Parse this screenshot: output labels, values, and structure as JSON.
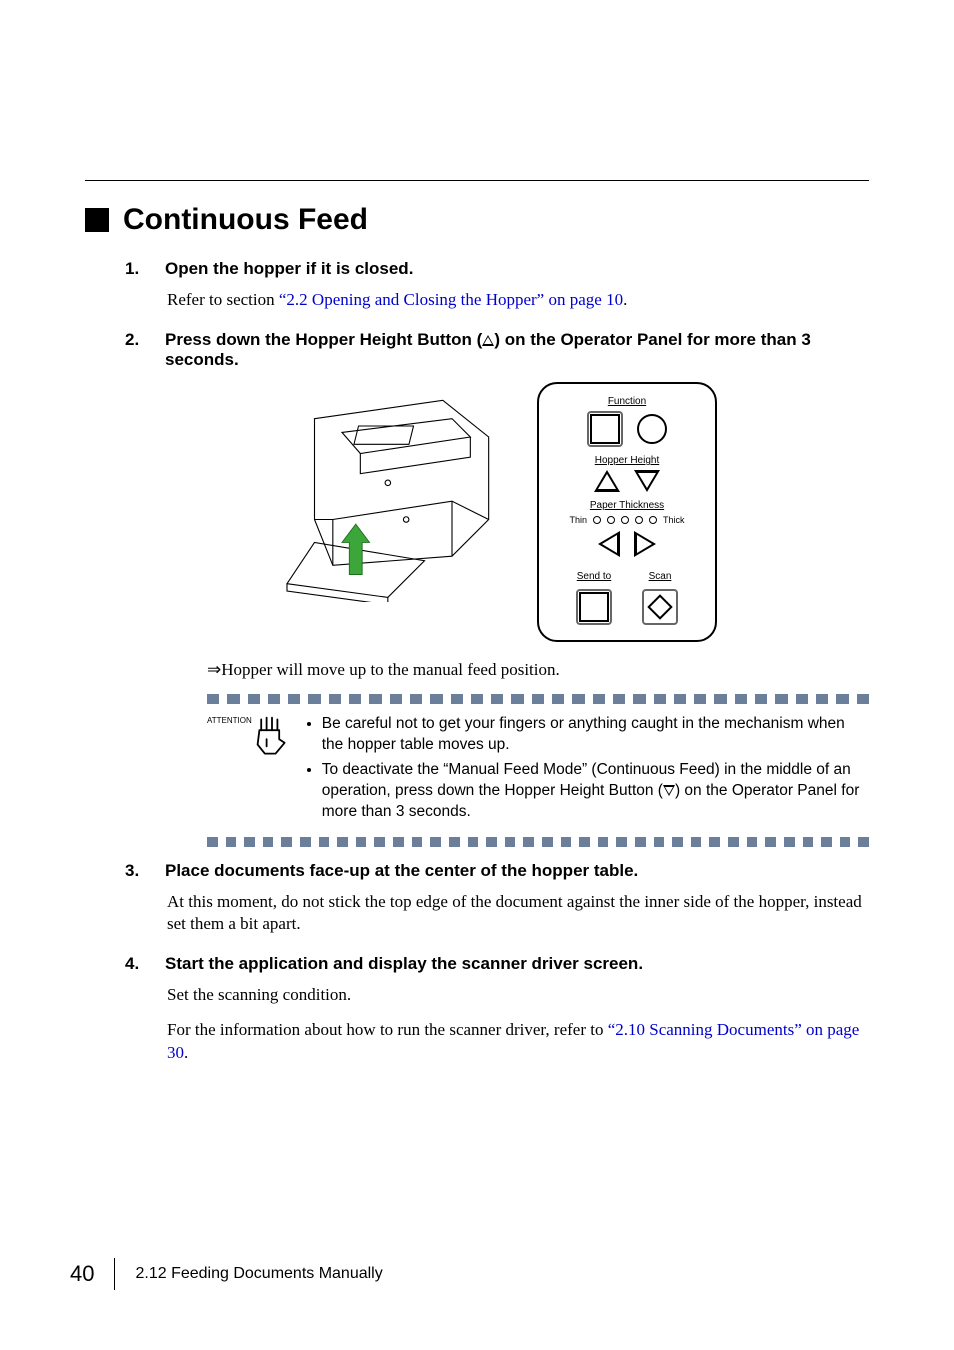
{
  "heading": "Continuous Feed",
  "steps": {
    "s1": {
      "num": "1.",
      "title": "Open the hopper if it is closed.",
      "ref_prefix": "Refer to section ",
      "ref_link": "“2.2 Opening and Closing the Hopper” on page 10",
      "ref_suffix": "."
    },
    "s2": {
      "num": "2.",
      "title_a": "Press down the Hopper Height Button (",
      "title_b": ") on the Operator Panel for more than 3 seconds."
    },
    "s3": {
      "num": "3.",
      "title": "Place documents face-up at the center of the hopper table.",
      "body": "At this moment, do not stick the top edge of the document against the inner side of the hopper, instead set them a bit apart."
    },
    "s4": {
      "num": "4.",
      "title": "Start the application and display the scanner driver screen.",
      "body1": "Set the scanning condition.",
      "body2a": "For the information about how to run the scanner driver, refer to ",
      "body2_link": "“2.10 Scanning Documents” on page 30",
      "body2b": "."
    }
  },
  "panel": {
    "function": "Function",
    "hopper": "Hopper Height",
    "paper": "Paper Thickness",
    "thin": "Thin",
    "thick": "Thick",
    "sendto": "Send to",
    "scan": "Scan"
  },
  "result": "⇒Hopper will move up to the manual feed position.",
  "attention": {
    "label": "ATTENTION",
    "li1": "Be careful not to get your fingers or anything caught in the mechanism when the hopper table moves up.",
    "li2a": "To deactivate the “Manual Feed Mode” (Continuous Feed) in the middle of an operation, press down the Hopper Height Button (",
    "li2b": ") on the Operator Panel for more than 3 seconds."
  },
  "footer": {
    "page": "40",
    "section": "2.12 Feeding Documents Manually"
  }
}
